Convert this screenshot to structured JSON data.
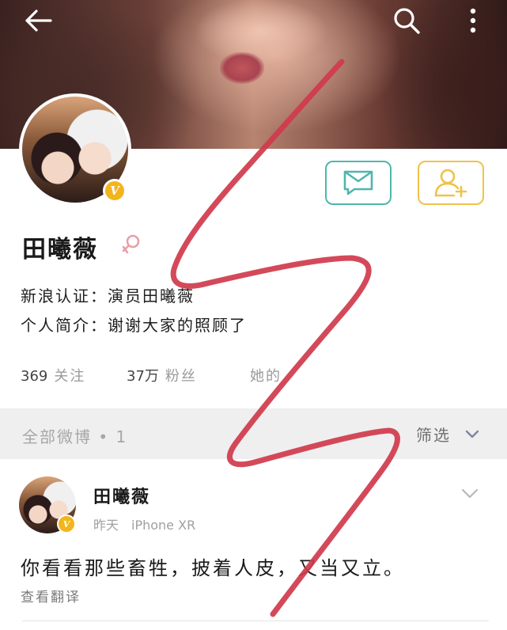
{
  "icons": {
    "back": "arrow-left-icon",
    "search": "search-icon",
    "more": "more-vertical-icon",
    "message": "message-icon",
    "follow": "add-user-icon",
    "gender": "female-icon",
    "verified": "verified-v-icon",
    "filter_chevron": "chevron-down-icon",
    "post_menu": "chevron-down-icon"
  },
  "colors": {
    "message_border": "#4fb6ad",
    "follow_border": "#f0c24a",
    "verified_badge": "#f2b51c",
    "gender_symbol": "#e8a0a8",
    "scribble": "#d03a4c"
  },
  "profile": {
    "name": "田曦薇",
    "verified_badge": "V",
    "certification_label": "新浪认证：",
    "certification_value": "演员田曦薇",
    "bio_label": "个人简介：",
    "bio_value": "谢谢大家的照顾了"
  },
  "stats": {
    "following_count": "369",
    "following_label": "关注",
    "followers_count": "37万",
    "followers_label": "粉丝",
    "third_label": "她的"
  },
  "filter": {
    "all_posts_label": "全部微博",
    "separator": "•",
    "all_posts_count": "1",
    "filter_label": "筛选"
  },
  "post": {
    "author": "田曦薇",
    "verified_badge": "V",
    "time": "昨天",
    "device": "iPhone XR",
    "text": "你看看那些畜牲，披着人皮，又当又立。",
    "translate_label": "查看翻译"
  }
}
